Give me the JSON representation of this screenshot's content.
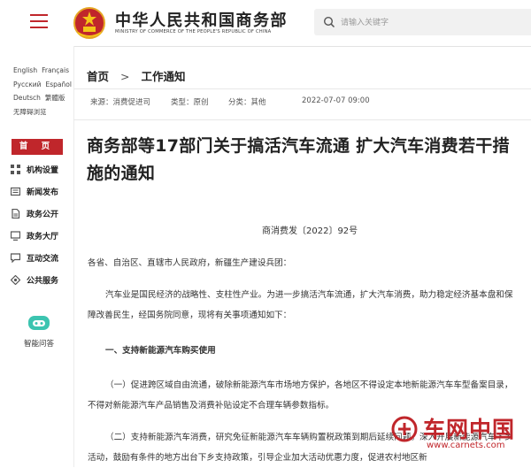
{
  "header": {
    "site_title": "中华人民共和国商务部",
    "site_subtitle": "MINISTRY OF COMMERCE OF THE PEOPLE'S REPUBLIC OF CHINA",
    "search_placeholder": "请输入关键字"
  },
  "sidebar": {
    "languages": [
      [
        "English",
        "Français"
      ],
      [
        "Русский",
        "Español"
      ],
      [
        "Deutsch",
        "繁體版"
      ],
      [
        "无障碍浏览"
      ]
    ],
    "home_label": "首 页",
    "items": [
      {
        "label": "机构设置",
        "icon": "org-chart-icon"
      },
      {
        "label": "新闻发布",
        "icon": "newspaper-icon"
      },
      {
        "label": "政务公开",
        "icon": "document-icon"
      },
      {
        "label": "政务大厅",
        "icon": "hall-icon"
      },
      {
        "label": "互动交流",
        "icon": "chat-icon"
      },
      {
        "label": "公共服务",
        "icon": "service-icon"
      }
    ],
    "assistant_label": "智能问答"
  },
  "breadcrumb": {
    "home": "首页",
    "separator": ">",
    "current": "工作通知"
  },
  "meta": {
    "source": "来源：消费促进司",
    "type": "类型：原创",
    "category": "分类：其他",
    "datetime": "2022-07-07 09:00"
  },
  "article": {
    "title": "商务部等17部门关于搞活汽车流通 扩大汽车消费若干措施的通知",
    "doc_number": "商消费发〔2022〕92号",
    "paragraphs": {
      "addressee": "各省、自治区、直辖市人民政府，新疆生产建设兵团：",
      "intro": "汽车业是国民经济的战略性、支柱性产业。为进一步搞活汽车流通，扩大汽车消费，助力稳定经济基本盘和保障改善民生，经国务院同意，现将有关事项通知如下：",
      "section1": "一、支持新能源汽车购买使用",
      "item1": "（一）促进跨区域自由流通，破除新能源汽车市场地方保护，各地区不得设定本地新能源汽车车型备案目录，不得对新能源汽车产品销售及消费补贴设定不合理车辆参数指标。",
      "item2": "（二）支持新能源汽车消费，研究免征新能源汽车车辆购置税政策到期后延续问题。深入开展新能源汽车下乡活动，鼓励有条件的地方出台下乡支持政策，引导企业加大活动优惠力度，促进农村地区新"
    }
  },
  "watermark": {
    "brand": "车网中国",
    "url": "www.carnets.com"
  },
  "colors": {
    "accent": "#c0262b",
    "text": "#333333"
  }
}
